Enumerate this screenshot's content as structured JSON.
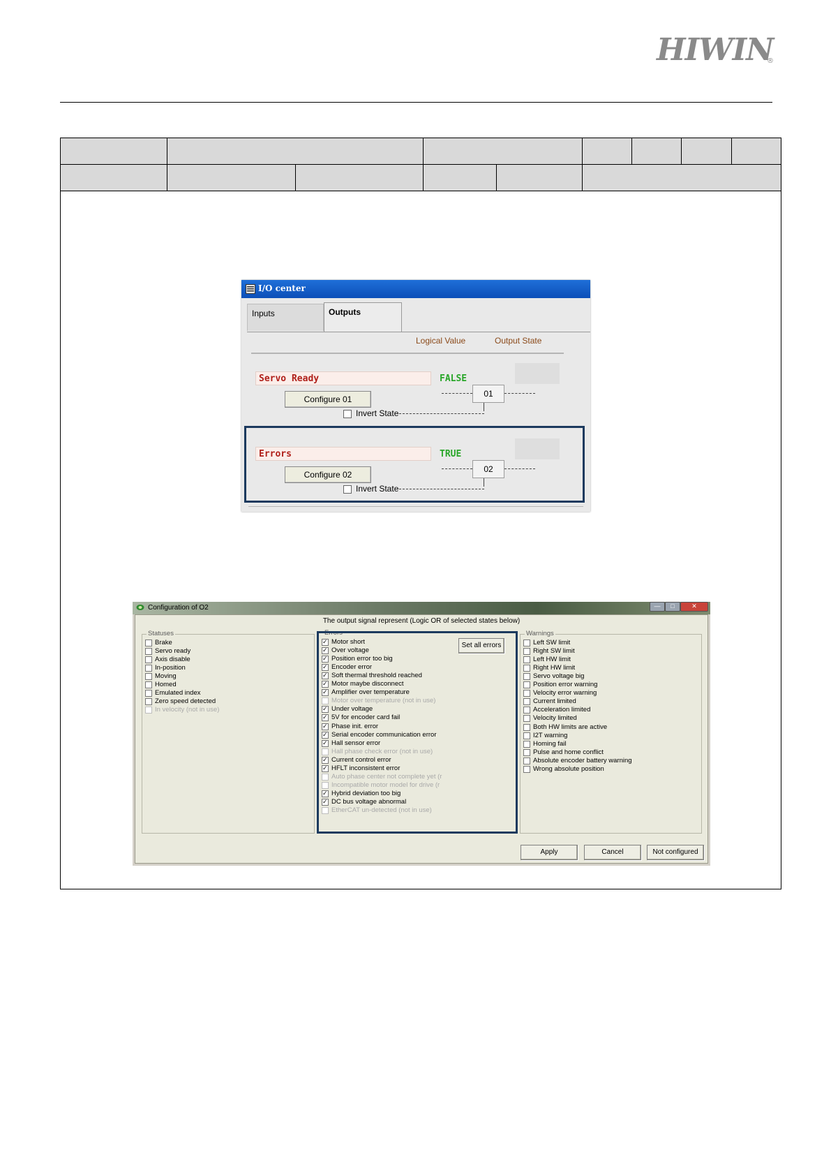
{
  "header": {
    "logo_text": "HIWIN"
  },
  "io_center": {
    "title": "I/O center",
    "tabs": [
      {
        "label": "Inputs",
        "active": false
      },
      {
        "label": "Outputs",
        "active": true
      }
    ],
    "columns": {
      "logical_value": "Logical Value",
      "output_state": "Output State"
    },
    "outputs": [
      {
        "name": "Servo Ready",
        "configure_label": "Configure 01",
        "logical_value": "FALSE",
        "output": "01",
        "invert_label": "Invert State",
        "invert_checked": false
      },
      {
        "name": "Errors",
        "configure_label": "Configure 02",
        "logical_value": "TRUE",
        "output": "02",
        "invert_label": "Invert State",
        "invert_checked": false
      }
    ],
    "colors": {
      "title_bar": "#0c4fb8",
      "true_false": "#29a629",
      "signal_name": "#b0201a",
      "highlight": "#1c3a5e"
    }
  },
  "configuration": {
    "title": "Configuration of O2",
    "heading": "The output signal represent  (Logic OR of selected states below)",
    "statuses": {
      "title": "Statuses",
      "items": [
        {
          "label": "Brake",
          "checked": false,
          "enabled": true
        },
        {
          "label": "Servo ready",
          "checked": false,
          "enabled": true
        },
        {
          "label": "Axis disable",
          "checked": false,
          "enabled": true
        },
        {
          "label": "In-position",
          "checked": false,
          "enabled": true
        },
        {
          "label": "Moving",
          "checked": false,
          "enabled": true
        },
        {
          "label": "Homed",
          "checked": false,
          "enabled": true
        },
        {
          "label": "Emulated index",
          "checked": false,
          "enabled": true
        },
        {
          "label": "Zero speed detected",
          "checked": false,
          "enabled": true
        },
        {
          "label": "In velocity (not in use)",
          "checked": false,
          "enabled": false
        }
      ]
    },
    "errors": {
      "title": "Errors",
      "set_all_label": "Set all errors",
      "items": [
        {
          "label": "Motor short",
          "checked": true,
          "enabled": true
        },
        {
          "label": "Over voltage",
          "checked": true,
          "enabled": true
        },
        {
          "label": "Position error too big",
          "checked": true,
          "enabled": true
        },
        {
          "label": "Encoder error",
          "checked": true,
          "enabled": true
        },
        {
          "label": "Soft thermal threshold reached",
          "checked": true,
          "enabled": true
        },
        {
          "label": "Motor maybe disconnect",
          "checked": true,
          "enabled": true
        },
        {
          "label": "Amplifier over temperature",
          "checked": true,
          "enabled": true
        },
        {
          "label": "Motor over temperature (not in use)",
          "checked": false,
          "enabled": false
        },
        {
          "label": "Under voltage",
          "checked": true,
          "enabled": true
        },
        {
          "label": "5V for encoder card fail",
          "checked": true,
          "enabled": true
        },
        {
          "label": "Phase init. error",
          "checked": true,
          "enabled": true
        },
        {
          "label": "Serial encoder communication error",
          "checked": true,
          "enabled": true
        },
        {
          "label": "Hall sensor error",
          "checked": true,
          "enabled": true
        },
        {
          "label": "Hall phase check error (not in use)",
          "checked": false,
          "enabled": false
        },
        {
          "label": "Current control error",
          "checked": true,
          "enabled": true
        },
        {
          "label": "HFLT inconsistent error",
          "checked": true,
          "enabled": true
        },
        {
          "label": "Auto phase center not complete yet (r",
          "checked": false,
          "enabled": false
        },
        {
          "label": "Incompatible motor model for drive (r",
          "checked": false,
          "enabled": false
        },
        {
          "label": "Hybrid deviation too big",
          "checked": true,
          "enabled": true
        },
        {
          "label": "DC bus voltage abnormal",
          "checked": true,
          "enabled": true
        },
        {
          "label": "EtherCAT un-detected (not in use)",
          "checked": false,
          "enabled": false
        }
      ]
    },
    "warnings": {
      "title": "Warnings",
      "items": [
        {
          "label": "Left SW limit",
          "checked": false,
          "enabled": true
        },
        {
          "label": "Right SW limit",
          "checked": false,
          "enabled": true
        },
        {
          "label": "Left HW limit",
          "checked": false,
          "enabled": true
        },
        {
          "label": "Right HW limit",
          "checked": false,
          "enabled": true
        },
        {
          "label": "Servo voltage big",
          "checked": false,
          "enabled": true
        },
        {
          "label": "Position error warning",
          "checked": false,
          "enabled": true
        },
        {
          "label": "Velocity error warning",
          "checked": false,
          "enabled": true
        },
        {
          "label": "Current limited",
          "checked": false,
          "enabled": true
        },
        {
          "label": "Acceleration limited",
          "checked": false,
          "enabled": true
        },
        {
          "label": "Velocity limited",
          "checked": false,
          "enabled": true
        },
        {
          "label": "Both HW limits are active",
          "checked": false,
          "enabled": true
        },
        {
          "label": "I2T warning",
          "checked": false,
          "enabled": true
        },
        {
          "label": "Homing fail",
          "checked": false,
          "enabled": true
        },
        {
          "label": "Pulse and home conflict",
          "checked": false,
          "enabled": true
        },
        {
          "label": "Absolute encoder battery warning",
          "checked": false,
          "enabled": true
        },
        {
          "label": "Wrong absolute position",
          "checked": false,
          "enabled": true
        }
      ]
    },
    "buttons": {
      "apply": "Apply",
      "cancel": "Cancel",
      "not_configured": "Not configured"
    },
    "window_buttons": {
      "minimize": "—",
      "maximize": "□",
      "close": "✕"
    }
  }
}
